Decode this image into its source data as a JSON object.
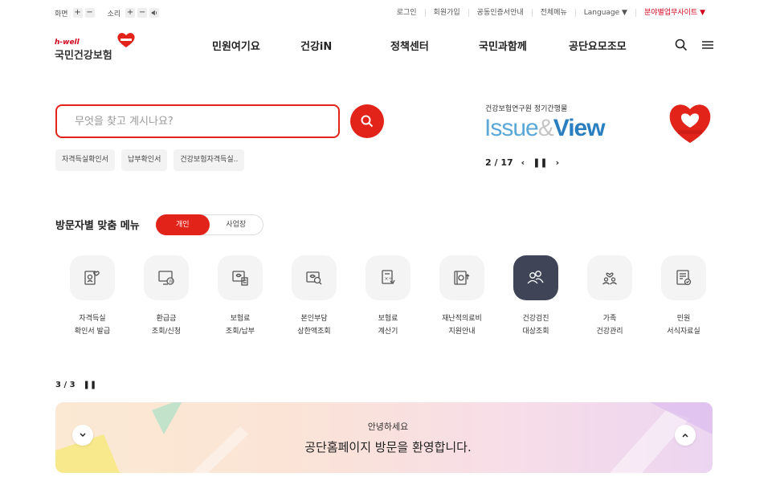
{
  "utility": {
    "screen_label": "화면",
    "sound_label": "소리",
    "plus": "+",
    "minus": "−",
    "links": [
      "로그인",
      "회원가입",
      "공동인증서안내",
      "전체메뉴",
      "Language ▼",
      "분야별업무사이트 ▼"
    ]
  },
  "logo": {
    "tagline": "h-well",
    "name": "국민건강보험"
  },
  "nav": [
    "민원여기요",
    "건강iN",
    "정책센터",
    "국민과함께",
    "공단요모조모"
  ],
  "search": {
    "placeholder": "무엇을 찾고 계시나요?"
  },
  "quick_tags": [
    "자격득실확인서",
    "납부확인서",
    "건강보험자격득실.."
  ],
  "issue": {
    "subtitle": "건강보험연구원 정기간행물",
    "title_a": "Issue",
    "title_amp": "&",
    "title_b": "View",
    "page": "2 / 17"
  },
  "visitor_menu": {
    "title": "방문자별 맞춤 메뉴",
    "toggle": [
      "개인",
      "사업장"
    ],
    "items": [
      {
        "l1": "자격득실",
        "l2": "확인서 발급",
        "icon": "certificate-icon"
      },
      {
        "l1": "환급금",
        "l2": "조회/신청",
        "icon": "monitor-refund-icon"
      },
      {
        "l1": "보험료",
        "l2": "조회/납부",
        "icon": "payment-icon"
      },
      {
        "l1": "본인부담",
        "l2": "상한액조회",
        "icon": "search-card-icon"
      },
      {
        "l1": "보험료",
        "l2": "계산기",
        "icon": "calculator-icon"
      },
      {
        "l1": "재난적의료비",
        "l2": "지원안내",
        "icon": "medical-support-icon"
      },
      {
        "l1": "건강검진",
        "l2": "대상조회",
        "icon": "people-check-icon"
      },
      {
        "l1": "가족",
        "l2": "건강관리",
        "icon": "family-icon"
      },
      {
        "l1": "민원",
        "l2": "서식자료실",
        "icon": "document-icon"
      }
    ]
  },
  "banner": {
    "page": "3 / 3",
    "subtitle": "안녕하세요",
    "title": "공단홈페이지 방문을 환영합니다."
  },
  "colors": {
    "brand_red": "#e2231a",
    "dark_slate": "#3f4556",
    "issue_blue": "#2a7fc0"
  }
}
